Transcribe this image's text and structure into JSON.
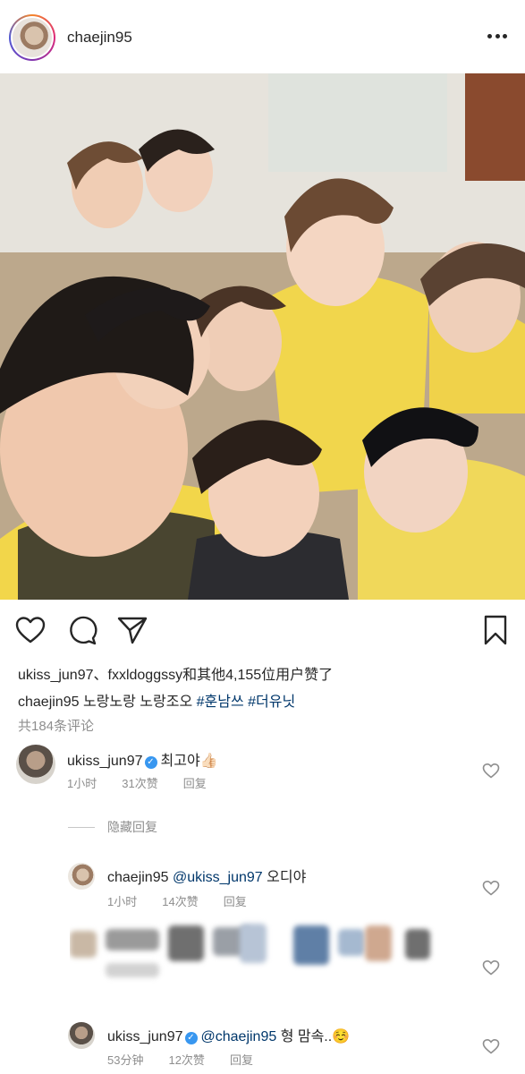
{
  "post": {
    "username": "chaejin95",
    "likes_text": "ukiss_jun97、fxxldoggssy和其他4,155位用户赞了",
    "caption_user": "chaejin95",
    "caption_text": "노랑노랑 노랑조오",
    "caption_tags": [
      "#훈남쓰",
      "#더유닛"
    ],
    "view_comments": "共184条评论"
  },
  "comments": [
    {
      "user": "ukiss_jun97",
      "verified": true,
      "text": "최고야👍🏻",
      "time": "1小时",
      "likes": "31次赞",
      "reply": "回复"
    }
  ],
  "hidden_replies_label": "隐藏回复",
  "replies": [
    {
      "user": "chaejin95",
      "verified": false,
      "mention": "@ukiss_jun97",
      "text": "오디야",
      "time": "1小时",
      "likes": "14次赞",
      "reply": "回复"
    },
    {
      "user": "ukiss_jun97",
      "verified": true,
      "mention": "@chaejin95",
      "text": "형 맘속..☺️",
      "time": "53分钟",
      "likes": "12次赞",
      "reply": "回复"
    }
  ],
  "colors": {
    "text": "#262626",
    "muted": "#8e8e8e",
    "link": "#00376b",
    "verified": "#3897f0"
  },
  "icons": [
    "more-icon",
    "heart-icon",
    "comment-icon",
    "share-icon",
    "bookmark-icon",
    "heart-small-icon",
    "verified-badge-icon"
  ]
}
